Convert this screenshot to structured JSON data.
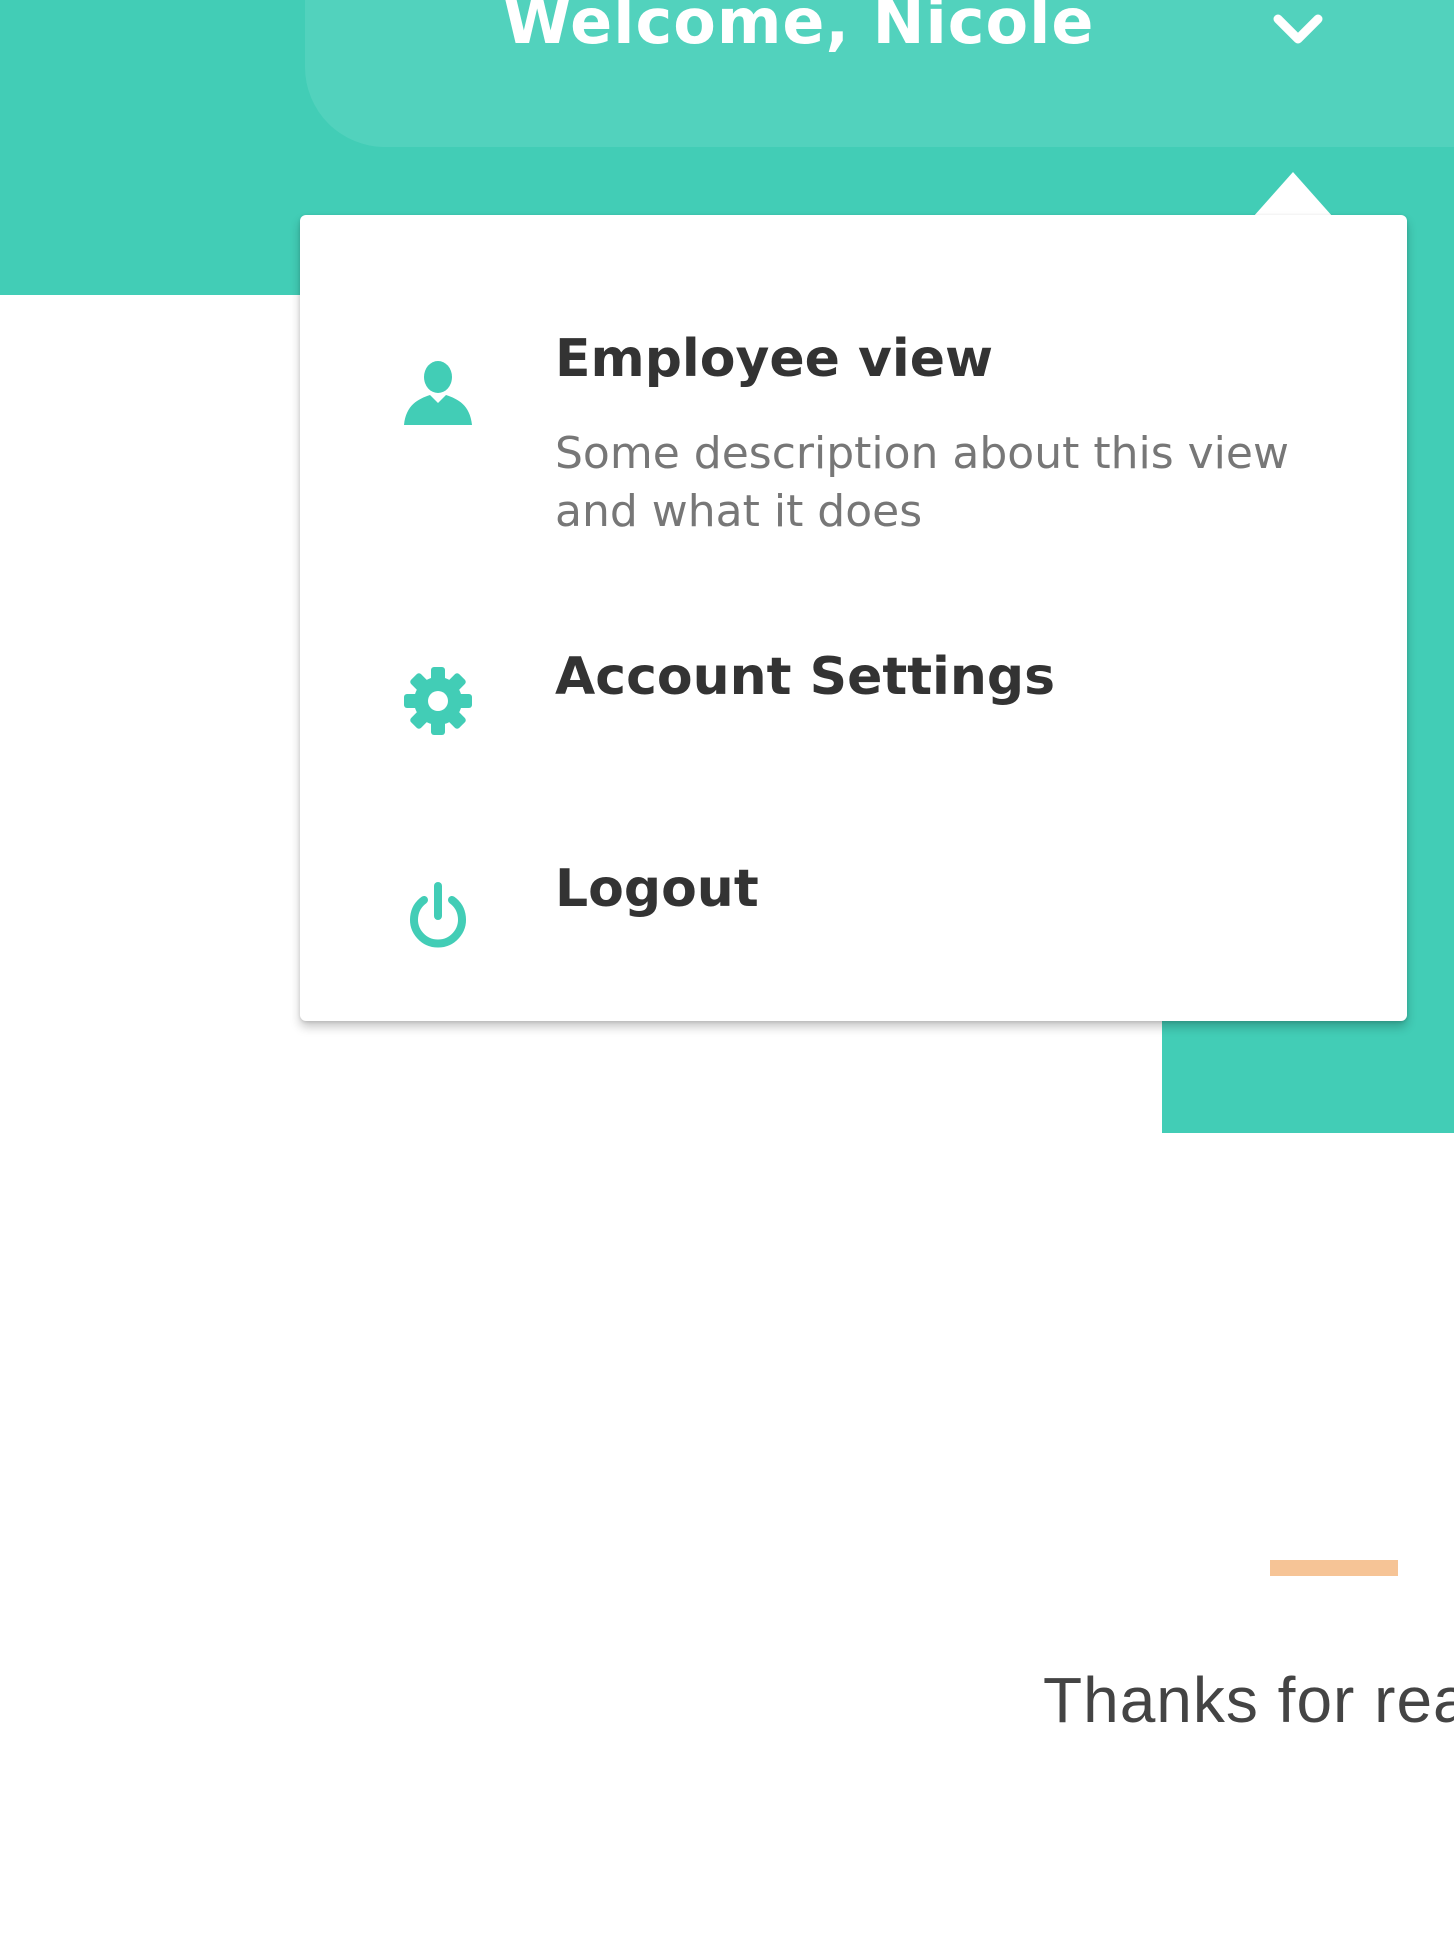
{
  "header": {
    "welcome": "Welcome, Nicole",
    "toggle_icon": "chevron-down-icon"
  },
  "menu": {
    "items": [
      {
        "label": "Employee view",
        "description": "Some description about this view and what it does",
        "icon": "user-icon"
      },
      {
        "label": "Account Settings",
        "icon": "gear-icon"
      },
      {
        "label": "Logout",
        "icon": "power-icon"
      }
    ]
  },
  "content": {
    "thanks": "Thanks for rea"
  },
  "colors": {
    "brand": "#42cdb6",
    "pill": "#52d2bd",
    "accent": "#f6c496",
    "text_dark": "#333333",
    "text_muted": "#777777"
  }
}
